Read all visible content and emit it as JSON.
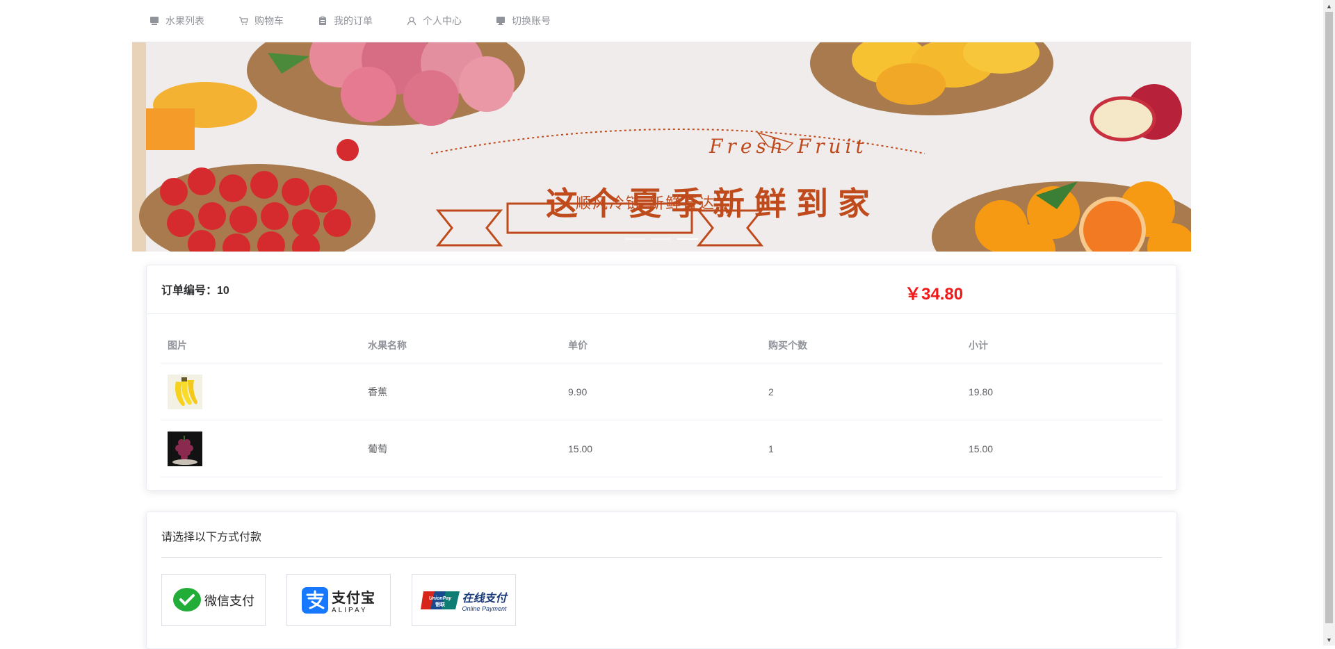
{
  "nav": {
    "items": [
      {
        "label": "水果列表",
        "icon": "fruit-list-icon"
      },
      {
        "label": "购物车",
        "icon": "cart-icon"
      },
      {
        "label": "我的订单",
        "icon": "clipboard-icon"
      },
      {
        "label": "个人中心",
        "icon": "user-icon"
      },
      {
        "label": "切换账号",
        "icon": "monitor-icon"
      }
    ]
  },
  "banner": {
    "title_en": "Fresh Fruit",
    "title_cn": "这个夏季新鲜到家",
    "subtitle": "顺风冷链 新鲜直达",
    "active_slide": 3,
    "slide_count": 3,
    "accent": "#bf4a1b"
  },
  "order": {
    "number_label": "订单编号：10",
    "total": "￥34.80",
    "total_color": "#f11a1a",
    "columns": [
      "图片",
      "水果名称",
      "单价",
      "购买个数",
      "小计"
    ],
    "rows": [
      {
        "image": "banana-image",
        "name": "香蕉",
        "price": "9.90",
        "qty": "2",
        "subtotal": "19.80"
      },
      {
        "image": "grape-image",
        "name": "葡萄",
        "price": "15.00",
        "qty": "1",
        "subtotal": "15.00"
      }
    ]
  },
  "payment": {
    "title": "请选择以下方式付款",
    "options": [
      {
        "label": "微信支付",
        "icon": "wechat-pay-icon"
      },
      {
        "label": "支付宝",
        "sub": "ALIPAY",
        "icon": "alipay-icon"
      },
      {
        "label": "在线支付",
        "sub": "Online Payment",
        "badge": "UnionPay 银联",
        "icon": "unionpay-icon"
      }
    ]
  }
}
